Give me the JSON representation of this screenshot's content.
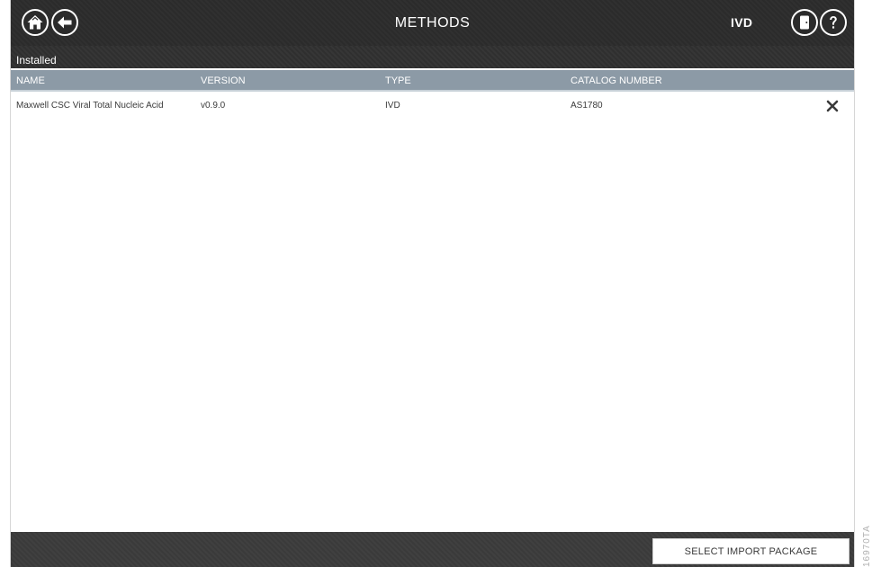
{
  "header": {
    "title": "METHODS",
    "mode_label": "IVD",
    "icons": {
      "home": "home-icon",
      "back": "back-arrow-icon",
      "logout": "door-exit-icon",
      "help": "help-icon"
    }
  },
  "section": {
    "title": "Installed"
  },
  "table": {
    "columns": [
      "NAME",
      "VERSION",
      "TYPE",
      "CATALOG NUMBER"
    ],
    "rows": [
      {
        "name": "Maxwell CSC Viral Total Nucleic Acid",
        "version": "v0.9.0",
        "type": "IVD",
        "catalog_number": "AS1780"
      }
    ]
  },
  "footer": {
    "import_button_label": "SELECT IMPORT PACKAGE"
  },
  "figure_code": "16970TA",
  "colors": {
    "header_bg": "#2b2b2b",
    "table_header_bg": "#8c9aa6",
    "footer_bg": "#3a3a3a"
  }
}
